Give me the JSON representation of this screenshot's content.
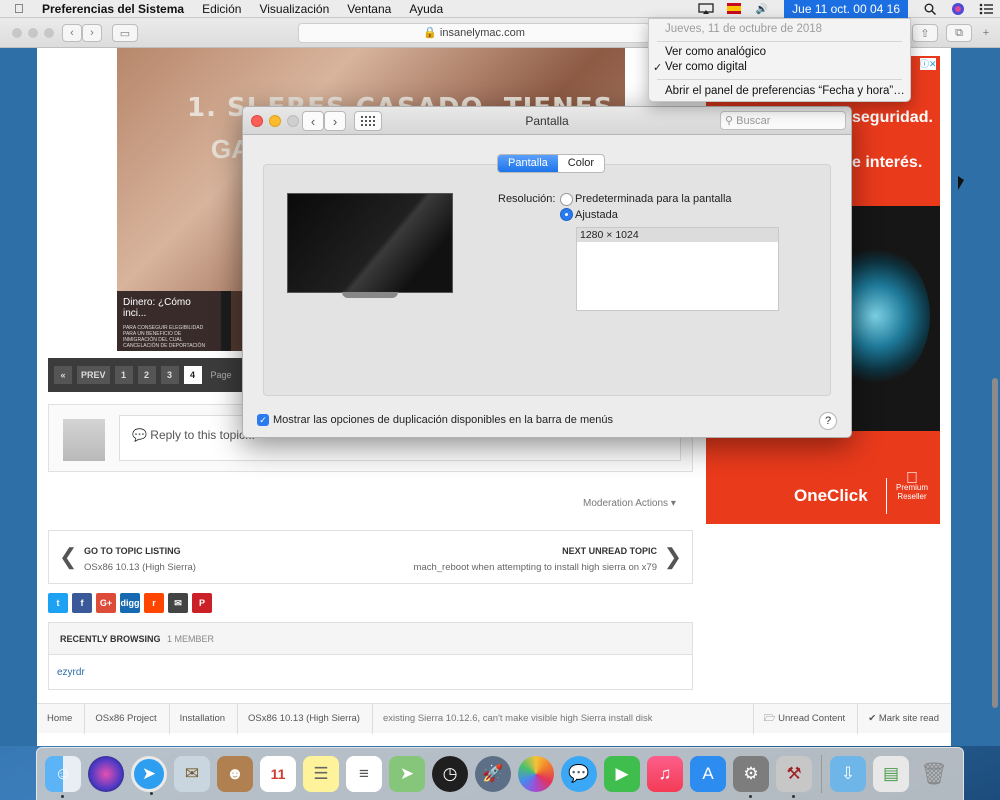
{
  "menubar": {
    "app_name": "Preferencias del Sistema",
    "items": [
      "Edición",
      "Visualización",
      "Ventana",
      "Ayuda"
    ],
    "clock": "Jue 11 oct.  00 04 16"
  },
  "browser": {
    "url": "insanelymac.com"
  },
  "clock_menu": {
    "date": "Jueves, 11 de octubre de 2018",
    "analog": "Ver como analógico",
    "digital": "Ver como digital",
    "check": "✓",
    "open_prefs": "Abrir el panel de preferencias “Fecha y hora”…"
  },
  "page": {
    "video_title_1": "1. SI ERES CASADO, TIENES HIJOS Y",
    "video_title_2": "GA",
    "thumb_title": "Dinero: ¿Cómo inci...",
    "thumb_sub": "PARA CONSEGUIR ELEGIBILIDAD PARA UN BENEFICIO DE INMIGRACIÓN DEL CUAL CANCELACIÓN DE DEPORTACIÓN",
    "pager": {
      "first": "«",
      "prev": "PREV",
      "pages": [
        "1",
        "2",
        "3"
      ],
      "current": "4",
      "label": "Page"
    },
    "reply_placeholder": "Reply to this topic...",
    "moderation": "Moderation Actions ▾",
    "go_to_listing": "GO TO TOPIC LISTING",
    "listing_sub": "OSx86 10.13 (High Sierra)",
    "next_unread": "NEXT UNREAD TOPIC",
    "next_sub": "mach_reboot when attempting to install high sierra on x79",
    "shares": [
      {
        "label": "t",
        "color": "#1da1f2"
      },
      {
        "label": "f",
        "color": "#3b5998"
      },
      {
        "label": "G+",
        "color": "#dd4b39"
      },
      {
        "label": "digg",
        "color": "#1769b2"
      },
      {
        "label": "r",
        "color": "#ff4500"
      },
      {
        "label": "✉",
        "color": "#444444"
      },
      {
        "label": "P",
        "color": "#cb2027"
      }
    ],
    "recently_browsing": "RECENTLY BROWSING",
    "member_count": "1 MEMBER",
    "member": "ezyrdr",
    "breadcrumb": [
      "Home",
      "OSx86 Project",
      "Installation",
      "OSx86 10.13 (High Sierra)"
    ],
    "breadcrumb_last": "existing Sierra 10.12.6, can't make visible high Sierra install disk",
    "unread_content": "Unread Content",
    "mark_read": "Mark site read"
  },
  "ad": {
    "line1": "seguridad.",
    "line2": "e interés.",
    "brand": "OneClick",
    "apple_line1": "Premium",
    "apple_line2": "Reseller"
  },
  "prefs": {
    "title": "Pantalla",
    "search_placeholder": "Buscar",
    "tabs": [
      "Pantalla",
      "Color"
    ],
    "resolution_label": "Resolución:",
    "option_default": "Predeterminada para la pantalla",
    "option_scaled": "Ajustada",
    "resolutions": [
      "1280 × 1024"
    ],
    "mirror_option": "Mostrar las opciones de duplicación disponibles en la barra de menús",
    "help": "?"
  }
}
